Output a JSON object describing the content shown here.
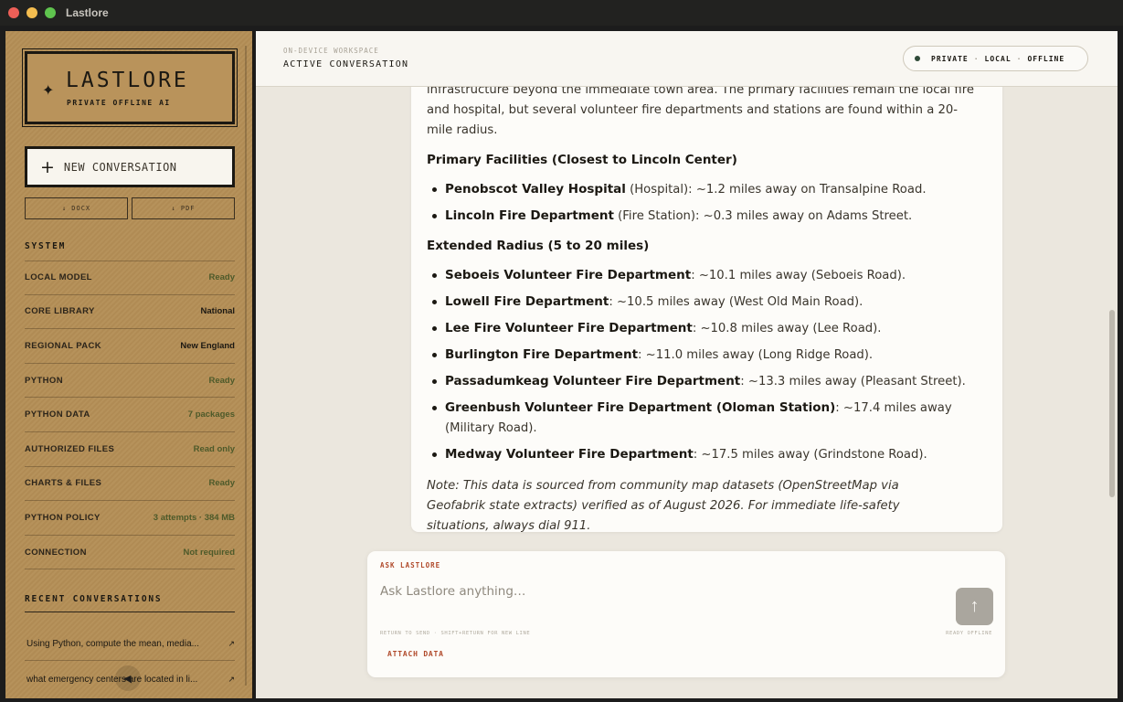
{
  "window": {
    "title": "Lastlore"
  },
  "sidebar": {
    "logo_title": "LASTLORE",
    "logo_subtitle": "PRIVATE OFFLINE AI",
    "logo_icon": "sparkle-icon",
    "new_conversation": "NEW CONVERSATION",
    "export_docx": "↓ DOCX",
    "export_pdf": "↓ PDF",
    "system_heading": "SYSTEM",
    "system": [
      {
        "key": "LOCAL MODEL",
        "value": "Ready"
      },
      {
        "key": "CORE LIBRARY",
        "value": "National"
      },
      {
        "key": "REGIONAL PACK",
        "value": "New England"
      },
      {
        "key": "PYTHON",
        "value": "Ready"
      },
      {
        "key": "PYTHON DATA",
        "value": "7 packages"
      },
      {
        "key": "AUTHORIZED FILES",
        "value": "Read only"
      },
      {
        "key": "CHARTS & FILES",
        "value": "Ready"
      },
      {
        "key": "PYTHON POLICY",
        "value": "3 attempts · 384 MB"
      },
      {
        "key": "CONNECTION",
        "value": "Not required"
      }
    ],
    "recent_heading": "RECENT CONVERSATIONS",
    "recent": [
      {
        "title": "Using Python, compute the mean, media...",
        "arrow": "↗"
      },
      {
        "title": "what emergency centers are located in li...",
        "arrow": "↗"
      }
    ]
  },
  "header": {
    "eyebrow": "ON-DEVICE WORKSPACE",
    "title": "ACTIVE CONVERSATION",
    "status": [
      "PRIVATE",
      "LOCAL",
      "OFFLINE"
    ],
    "status_sep": "·"
  },
  "message": {
    "intro": "infrastructure beyond the immediate town area. The primary facilities remain the local fire and hospital, but several volunteer fire departments and stations are found within a 20-mile radius.",
    "section1_heading": "Primary Facilities (Closest to Lincoln Center)",
    "section1_items": [
      {
        "name": "Penobscot Valley Hospital",
        "detail": " (Hospital): ~1.2 miles away on Transalpine Road."
      },
      {
        "name": "Lincoln Fire Department",
        "detail": " (Fire Station): ~0.3 miles away on Adams Street."
      }
    ],
    "section2_heading": "Extended Radius (5 to 20 miles)",
    "section2_items": [
      {
        "name": "Seboeis Volunteer Fire Department",
        "detail": ": ~10.1 miles away (Seboeis Road)."
      },
      {
        "name": "Lowell Fire Department",
        "detail": ": ~10.5 miles away (West Old Main Road)."
      },
      {
        "name": "Lee Fire Volunteer Fire Department",
        "detail": ": ~10.8 miles away (Lee Road)."
      },
      {
        "name": "Burlington Fire Department",
        "detail": ": ~11.0 miles away (Long Ridge Road)."
      },
      {
        "name": "Passadumkeag Volunteer Fire Department",
        "detail": ": ~13.3 miles away (Pleasant Street)."
      },
      {
        "name": "Greenbush Volunteer Fire Department (Oloman Station)",
        "detail": ": ~17.4 miles away (Military Road)."
      },
      {
        "name": "Medway Volunteer Fire Department",
        "detail": ": ~17.5 miles away (Grindstone Road)."
      }
    ],
    "note": "Note: This data is sourced from community map datasets (OpenStreetMap via Geofabrik state extracts) verified as of August 2026. For immediate life-safety situations, always dial 911."
  },
  "composer": {
    "label": "ASK LASTLORE",
    "placeholder": "Ask Lastlore anything…",
    "send_icon": "arrow-up-icon",
    "send_glyph": "↑",
    "hint": "RETURN TO SEND · SHIFT+RETURN FOR NEW LINE",
    "status": "READY OFFLINE",
    "attach": "ATTACH DATA"
  },
  "colors": {
    "sidebar": "#b48e56",
    "accent": "#b0492a",
    "ready_green": "#4d5a2a"
  }
}
